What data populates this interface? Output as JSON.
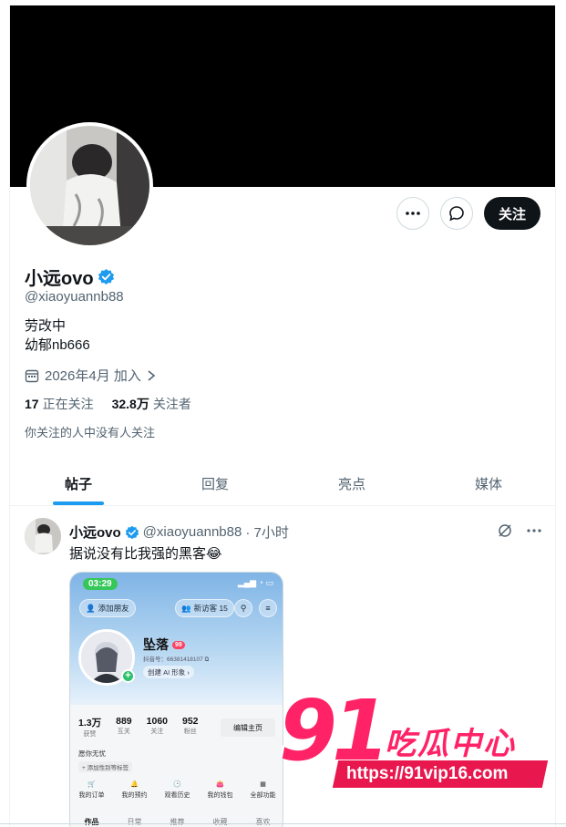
{
  "profile": {
    "display_name": "小远ovo",
    "handle": "@xiaoyuannb88",
    "bio_line1": "劳改中",
    "bio_line2": "幼郁nb666",
    "joined": "2026年4月 加入",
    "following_count": "17",
    "following_label": "正在关注",
    "followers_count": "32.8万",
    "followers_label": "关注者",
    "mutual_note": "你关注的人中没有人关注",
    "follow_button": "关注",
    "verified_color": "#1d9bf0"
  },
  "tabs": [
    {
      "label": "帖子",
      "active": true
    },
    {
      "label": "回复",
      "active": false
    },
    {
      "label": "亮点",
      "active": false
    },
    {
      "label": "媒体",
      "active": false
    }
  ],
  "post": {
    "author": "小远ovo",
    "handle": "@xiaoyuannb88",
    "time": "· 7小时",
    "text": "据说没有比我强的黑客😂"
  },
  "embedded_screenshot": {
    "status_time": "03:29",
    "add_friend": "添加朋友",
    "new_visitors": "新访客 15",
    "name": "坠落",
    "level": "99",
    "id_line": "抖音号：66381418107 ⧉",
    "ai_pill": "创建 AI 形象 ›",
    "stats": [
      {
        "value": "1.3万",
        "label": "获赞"
      },
      {
        "value": "889",
        "label": "互关"
      },
      {
        "value": "1060",
        "label": "关注"
      },
      {
        "value": "952",
        "label": "粉丝"
      }
    ],
    "edit_button": "编辑主页",
    "intro": "愿你无忧",
    "tag_pill": "+ 添加性别等标签",
    "menu": [
      "我的订单",
      "我的预约",
      "观看历史",
      "我的钱包",
      "全部功能"
    ],
    "tabs": [
      "作品",
      "日常",
      "推荐",
      "收藏",
      "喜欢"
    ]
  },
  "watermark": {
    "number": "91",
    "text": "吃瓜中心",
    "url": "https://91vip16.com",
    "color": "#ff2266"
  }
}
